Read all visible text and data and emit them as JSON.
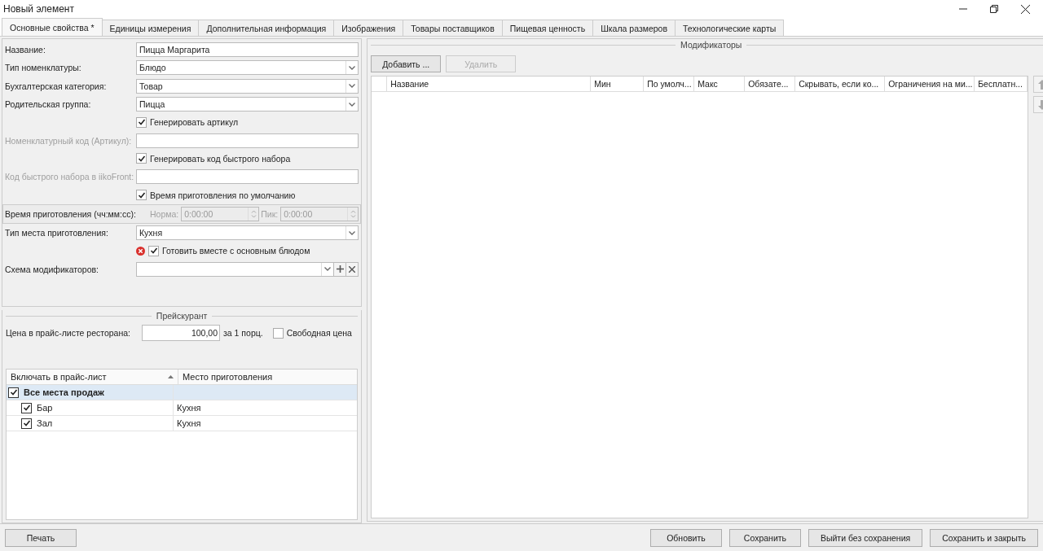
{
  "window": {
    "title": "Новый элемент"
  },
  "tabs": [
    {
      "label": "Основные свойства *",
      "selected": true
    },
    {
      "label": "Единицы измерения",
      "selected": false
    },
    {
      "label": "Дополнительная информация",
      "selected": false
    },
    {
      "label": "Изображения",
      "selected": false
    },
    {
      "label": "Товары поставщиков",
      "selected": false
    },
    {
      "label": "Пищевая ценность",
      "selected": false
    },
    {
      "label": "Шкала размеров",
      "selected": false
    },
    {
      "label": "Технологические карты",
      "selected": false
    }
  ],
  "form": [
    {
      "kind": "text",
      "label": "Название:",
      "value": "Пицца Маргарита",
      "disabled": false
    },
    {
      "kind": "select",
      "label": "Тип номенклатуры:",
      "value": "Блюдо"
    },
    {
      "kind": "select",
      "label": "Бухгалтерская категория:",
      "value": "Товар"
    },
    {
      "kind": "select",
      "label": "Родительская группа:",
      "value": "Пицца"
    },
    {
      "kind": "checkbox",
      "label": "Генерировать артикул",
      "checked": true,
      "error": false
    },
    {
      "kind": "text",
      "label": "Номенклатурный код (Артикул):",
      "disabled": true
    },
    {
      "kind": "checkbox",
      "label": "Генерировать код быстрого набора",
      "checked": true,
      "error": false
    },
    {
      "kind": "text",
      "label": "Код быстрого набора в iikoFront:",
      "disabled": true
    },
    {
      "kind": "checkbox",
      "label": "Время приготовления по умолчанию",
      "checked": true,
      "error": false
    },
    {
      "kind": "time",
      "label": "Время приготовления (чч:мм:сс):",
      "disabled": true,
      "parts": [
        {
          "label": "Норма:",
          "value": "0:00:00"
        },
        {
          "label": "Пик:",
          "value": "0:00:00"
        }
      ]
    },
    {
      "kind": "select",
      "label": "Тип места приготовления:",
      "value": "Кухня"
    },
    {
      "kind": "checkbox",
      "label": "Готовить вместе с основным блюдом",
      "checked": true,
      "error": true
    },
    {
      "kind": "picker",
      "label": "Схема модификаторов:"
    }
  ],
  "price": {
    "legend": "Прейскурант",
    "label": "Цена в прайс-листе ресторана:",
    "value": "100,00",
    "unit": "за 1 порц.",
    "free_price": {
      "label": "Свободная цена",
      "checked": false
    }
  },
  "price_table": {
    "columns": [
      "Включать в прайс-лист",
      "Место приготовления"
    ],
    "rows": [
      {
        "label": "Все места продаж",
        "checked": true,
        "selected": true,
        "children": [
          {
            "label": "Бар",
            "place": "Кухня",
            "checked": true,
            "selected": false
          },
          {
            "label": "Зал",
            "place": "Кухня",
            "checked": true,
            "selected": false
          }
        ]
      }
    ]
  },
  "modifiers": {
    "legend": "Модификаторы",
    "buttons": [
      {
        "label": "Добавить ...",
        "disabled": false
      },
      {
        "label": "Удалить",
        "disabled": true
      }
    ],
    "columns": [
      "Название",
      "Мин",
      "По умолч...",
      "Макс",
      "Обязате...",
      "Скрывать, если ко...",
      "Ограничения на ми...",
      "Бесплатн..."
    ]
  },
  "footer": {
    "left": [
      "Печать"
    ],
    "right": [
      "Обновить",
      "Сохранить",
      "Выйти без сохранения",
      "Сохранить и закрыть"
    ]
  }
}
